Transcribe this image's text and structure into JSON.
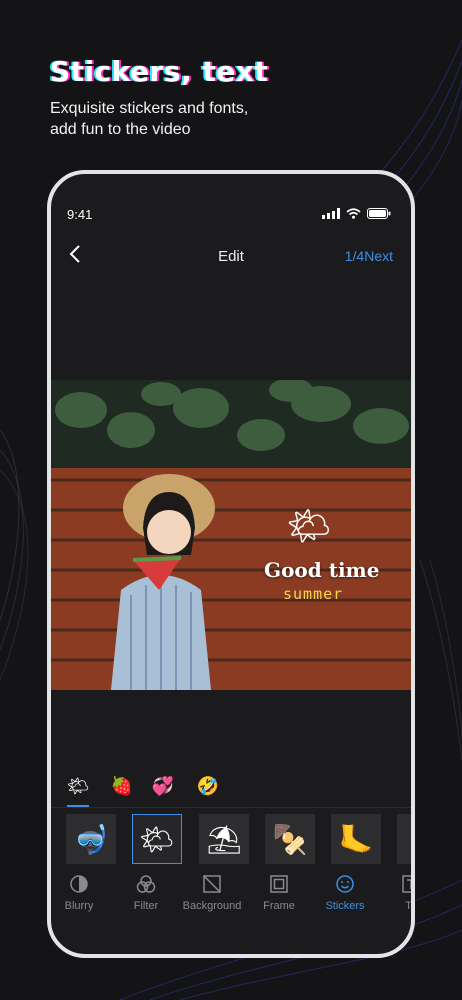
{
  "promo": {
    "headline": "Stickers, text",
    "subline_line1": "Exquisite stickers and fonts,",
    "subline_line2": "add fun to the video"
  },
  "status_bar": {
    "time": "9:41"
  },
  "nav": {
    "back": "<",
    "title": "Edit",
    "next_label": "1/4Next"
  },
  "canvas": {
    "overlay_sticker": "🌤",
    "overlay_title": "Good time",
    "overlay_subtitle": "summer"
  },
  "sticker_categories": [
    {
      "icon": "🌤",
      "name": "weather-sticker-category"
    },
    {
      "icon": "🍓",
      "name": "strawberry-sticker-category"
    },
    {
      "icon": "💞",
      "name": "hearts-sticker-category"
    },
    {
      "icon": "🤣",
      "name": "emoji-sticker-category"
    }
  ],
  "sticker_items": [
    {
      "icon": "🤿",
      "name": "snorkel-sticker"
    },
    {
      "icon": "🌤",
      "name": "sun-cloud-sticker"
    },
    {
      "icon": "⛱",
      "name": "umbrella-sticker"
    },
    {
      "icon": "🍢",
      "name": "popsicle-sticker"
    },
    {
      "icon": "🦶",
      "name": "flippers-sticker"
    }
  ],
  "toolbar": {
    "items": [
      {
        "label": "Blurry"
      },
      {
        "label": "Filter"
      },
      {
        "label": "Background"
      },
      {
        "label": "Frame"
      },
      {
        "label": "Stickers"
      },
      {
        "label": "Te"
      }
    ],
    "active_index": 4
  },
  "colors": {
    "accent": "#3d8fe6",
    "background": "#141416",
    "panel": "#1b1b1d"
  }
}
